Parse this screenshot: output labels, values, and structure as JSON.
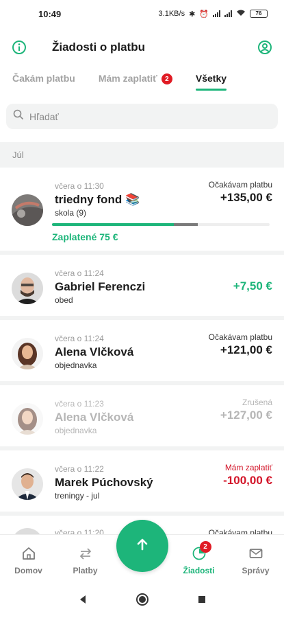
{
  "status_bar": {
    "time": "10:49",
    "speed": "3.1KB/s",
    "battery": "76"
  },
  "header": {
    "title": "Žiadosti o platbu",
    "info_icon": "info-icon",
    "profile_icon": "profile-icon"
  },
  "tabs": [
    {
      "label": "Čakám platbu"
    },
    {
      "label": "Mám zaplatiť",
      "badge": "2"
    },
    {
      "label": "Všetky"
    }
  ],
  "search": {
    "placeholder": "Hľadať"
  },
  "section": {
    "label": "Júl"
  },
  "items": [
    {
      "time": "včera o 11:30",
      "name": "triedny fond 📚",
      "sub": "skola (9)",
      "status": "Očakávam platbu",
      "amount": "+135,00 €",
      "paid_label": "Zaplatené 75 €",
      "paid_fraction": 0.56,
      "pending_fraction": 0.11
    },
    {
      "time": "včera o 11:24",
      "name": "Gabriel Ferenczi",
      "sub": "obed",
      "status": "",
      "amount": "+7,50 €"
    },
    {
      "time": "včera o 11:24",
      "name": "Alena Vlčková",
      "sub": "objednavka",
      "status": "Očakávam platbu",
      "amount": "+121,00 €"
    },
    {
      "time": "včera o 11:23",
      "name": "Alena Vlčková",
      "sub": "objednavka",
      "status": "Zrušená",
      "amount": "+127,00 €"
    },
    {
      "time": "včera o 11:22",
      "name": "Marek Púchovský",
      "sub": "treningy - jul",
      "status": "Mám zaplatiť",
      "amount": "-100,00 €"
    },
    {
      "time": "včera o 11:20",
      "name": "",
      "sub": "",
      "status": "Očakávam platbu",
      "amount": ""
    }
  ],
  "bottom_nav": [
    {
      "label": "Domov",
      "icon": "home-icon"
    },
    {
      "label": "Platby",
      "icon": "transfer-icon"
    },
    {
      "label": "Žiadosti",
      "icon": "requests-icon",
      "badge": "2"
    },
    {
      "label": "Správy",
      "icon": "mail-icon"
    }
  ],
  "colors": {
    "accent": "#1db57a",
    "negative": "#d3162a",
    "badge": "#e01b24"
  }
}
